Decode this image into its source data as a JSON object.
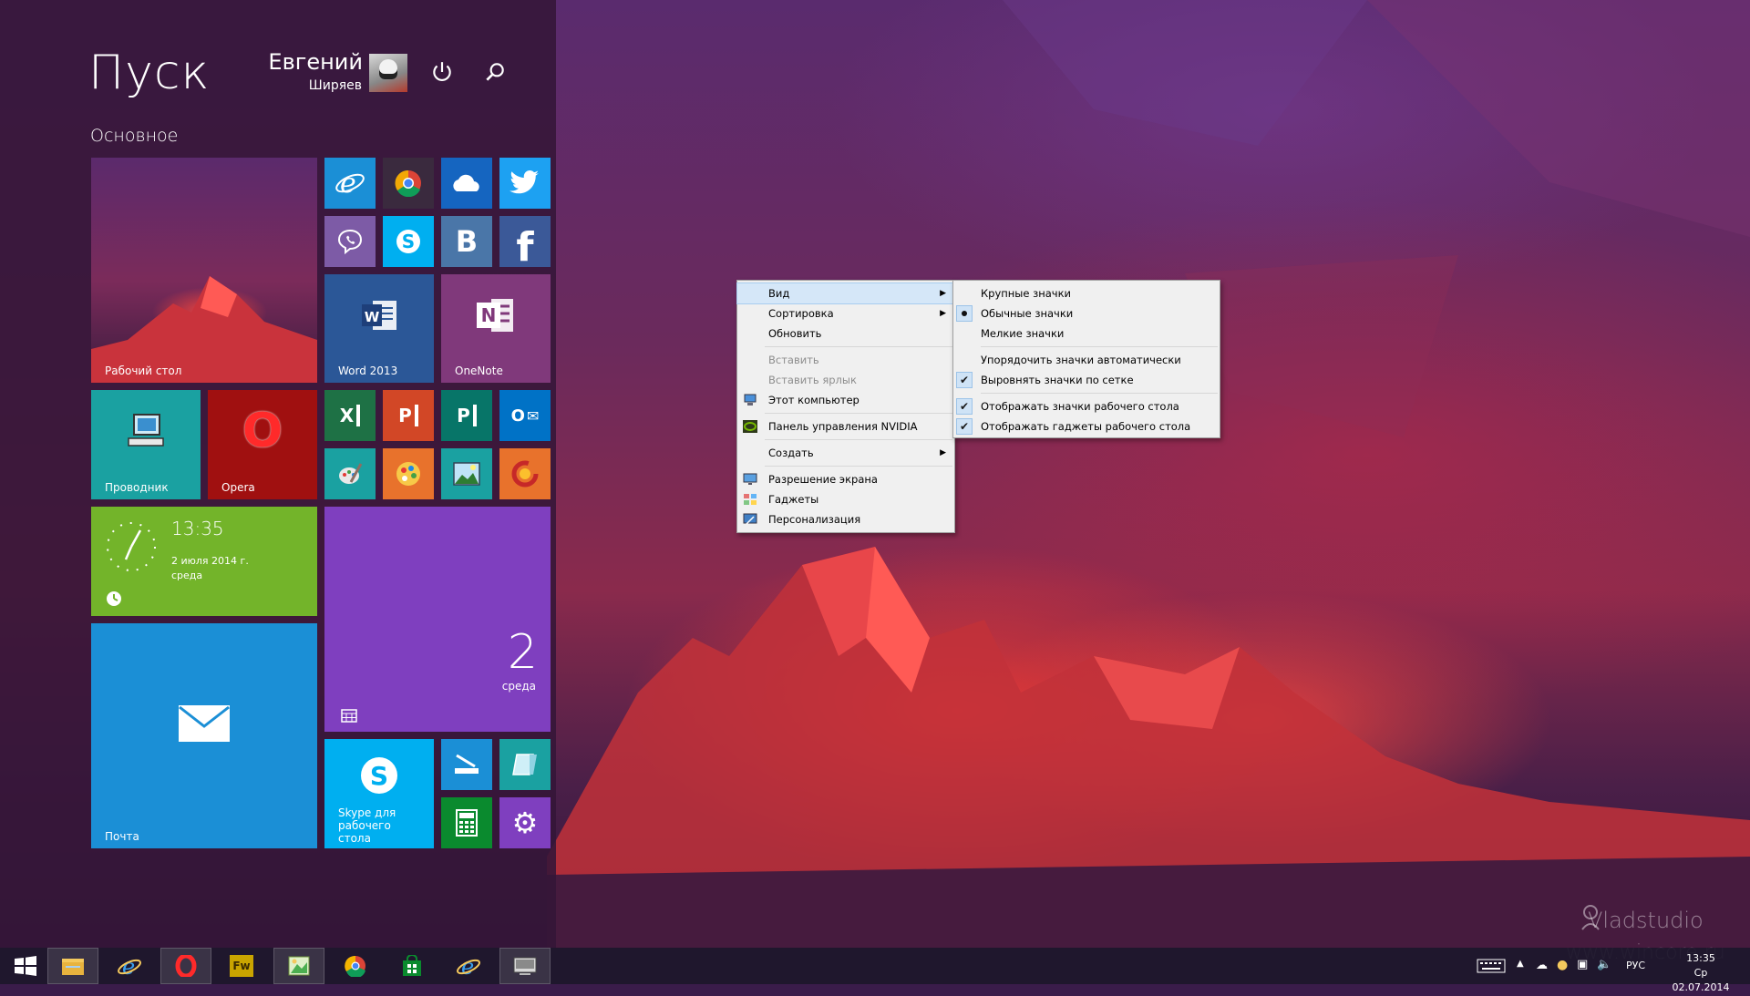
{
  "start": {
    "title": "Пуск",
    "user_first": "Евгений",
    "user_last": "Ширяев",
    "section": "Основное"
  },
  "tiles": {
    "desktop": "Рабочий стол",
    "word": "Word 2013",
    "onenote": "OneNote",
    "explorer": "Проводник",
    "opera": "Opera",
    "skype_desktop": "Skype для рабочего стола",
    "mail": "Почта",
    "clock_time": "13:35",
    "clock_date": "2 июля 2014 г.",
    "clock_weekday": "среда",
    "calendar_day": "2",
    "calendar_weekday": "среда",
    "small_letters": {
      "vk": "B",
      "facebook": "f",
      "excel": "X",
      "powerpoint": "P",
      "publisher": "P",
      "outlook": "O",
      "word": "W",
      "onenote": "N",
      "opera": "O"
    }
  },
  "context_menu": {
    "items": [
      {
        "label": "Вид"
      },
      {
        "label": "Сортировка"
      },
      {
        "label": "Обновить"
      },
      {
        "label": "Вставить"
      },
      {
        "label": "Вставить ярлык"
      },
      {
        "label": "Этот компьютер"
      },
      {
        "label": "Панель управления NVIDIA"
      },
      {
        "label": "Создать"
      },
      {
        "label": "Разрешение экрана"
      },
      {
        "label": "Гаджеты"
      },
      {
        "label": "Персонализация"
      }
    ],
    "submenu": [
      {
        "label": "Крупные значки"
      },
      {
        "label": "Обычные значки"
      },
      {
        "label": "Мелкие значки"
      },
      {
        "label": "Упорядочить значки автоматически"
      },
      {
        "label": "Выровнять значки по сетке"
      },
      {
        "label": "Отображать значки рабочего стола"
      },
      {
        "label": "Отображать гаджеты  рабочего стола"
      }
    ]
  },
  "taskbar": {
    "fireworks_label": "Fw",
    "language": "РУС",
    "time": "13:35",
    "date": "Ср 02.07.2014"
  },
  "watermark": {
    "brand": "Vladstudio",
    "site": "www.wincore.ru"
  },
  "colors": {
    "start_bg": "#341638",
    "ie_tile": "#1b8fd6",
    "chrome_tile": "#3a2a3e",
    "onedrive_tile": "#1565c0",
    "twitter_tile": "#1da1f2",
    "viber_tile": "#7d5ba6",
    "skype_tile": "#00aff0",
    "vk_tile": "#4a76a8",
    "facebook_tile": "#3b5998",
    "word_tile": "#2b5797",
    "onenote_tile": "#80397b",
    "explorer_tile": "#1aa1a1",
    "opera_tile": "#a01010",
    "excel_tile": "#1e7145",
    "powerpoint_tile": "#d24726",
    "publisher_tile": "#077568",
    "outlook_tile": "#0072c6",
    "clock_tile": "#73b42a",
    "calendar_tile": "#7f3fbf",
    "mail_tile": "#1b8fd6",
    "menu_bg": "#f0f0f0",
    "menu_highlight": "#d5e7f8"
  }
}
